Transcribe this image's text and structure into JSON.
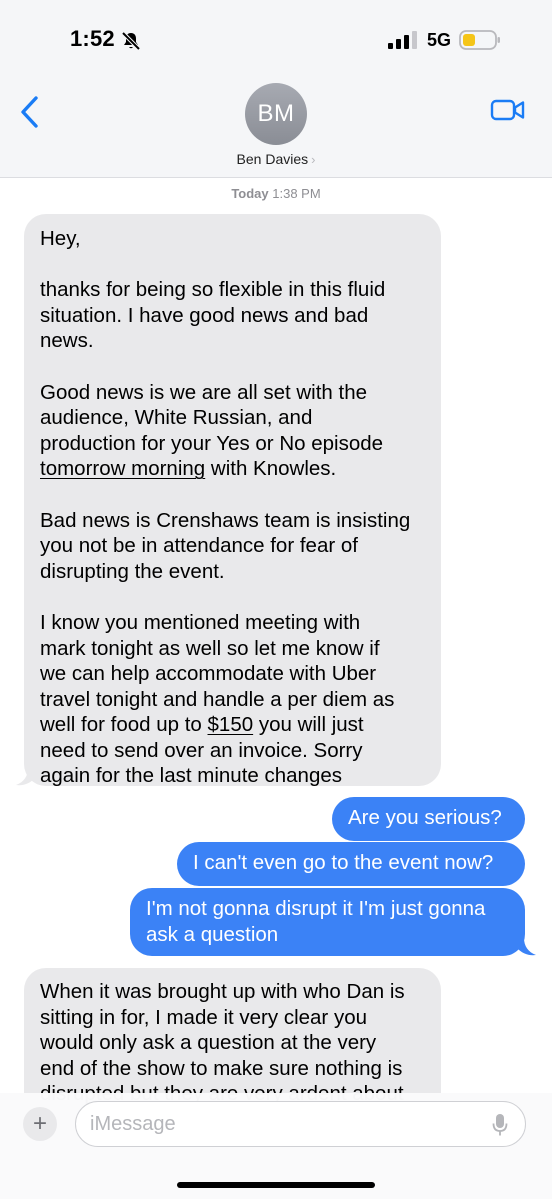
{
  "status_bar": {
    "time": "1:52",
    "network": "5G",
    "icons": [
      "bell-slash-icon",
      "signal-icon",
      "battery-icon"
    ]
  },
  "header": {
    "avatar_initials": "BM",
    "contact_name": "Ben Davies",
    "chevron": "›",
    "icons": [
      "back-chevron-icon",
      "video-camera-icon"
    ]
  },
  "timestamp": {
    "day": "Today",
    "time": "1:38 PM"
  },
  "messages": [
    {
      "direction": "incoming",
      "paragraphs": [
        [
          "Hey,"
        ],
        [
          "thanks for being so flexible in this fluid",
          "situation. I have good news and bad",
          "news."
        ],
        [
          "Good news is we are all set with the",
          "audience, White Russian, and",
          "production for your Yes or No episode",
          "tomorrow morning",
          " with Knowles."
        ],
        [
          "Bad news is Crenshaws team is insisting",
          "you not be in attendance for fear of",
          "disrupting the event."
        ],
        [
          "I know you mentioned meeting with",
          "mark tonight as well so let me know if",
          "we can help accommodate with  Uber",
          "travel tonight and handle a per diem as",
          "well for food up to ",
          "$150",
          " you will just",
          "need to send over an invoice. Sorry",
          "again for the last minute changes"
        ]
      ]
    },
    {
      "direction": "outgoing",
      "lines": [
        "Are you serious?"
      ]
    },
    {
      "direction": "outgoing",
      "lines": [
        "I can't even go to the event now?"
      ]
    },
    {
      "direction": "outgoing",
      "lines": [
        "I'm not gonna disrupt it I'm just gonna",
        "ask a question"
      ]
    },
    {
      "direction": "incoming",
      "lines": [
        "When it was brought up with who Dan is",
        "sitting in for, I made it very clear you",
        "would only ask a question at the very",
        "end of the show to make sure nothing is",
        "disrupted but they are very ardent about"
      ]
    }
  ],
  "compose": {
    "placeholder": "iMessage",
    "plus_label": "+",
    "icons": [
      "plus-icon",
      "microphone-icon"
    ]
  },
  "colors": {
    "incoming_bubble": "#e9e9eb",
    "outgoing_bubble": "#3b82f6",
    "accent": "#1a7cf5",
    "battery_fill": "#f5c518"
  }
}
